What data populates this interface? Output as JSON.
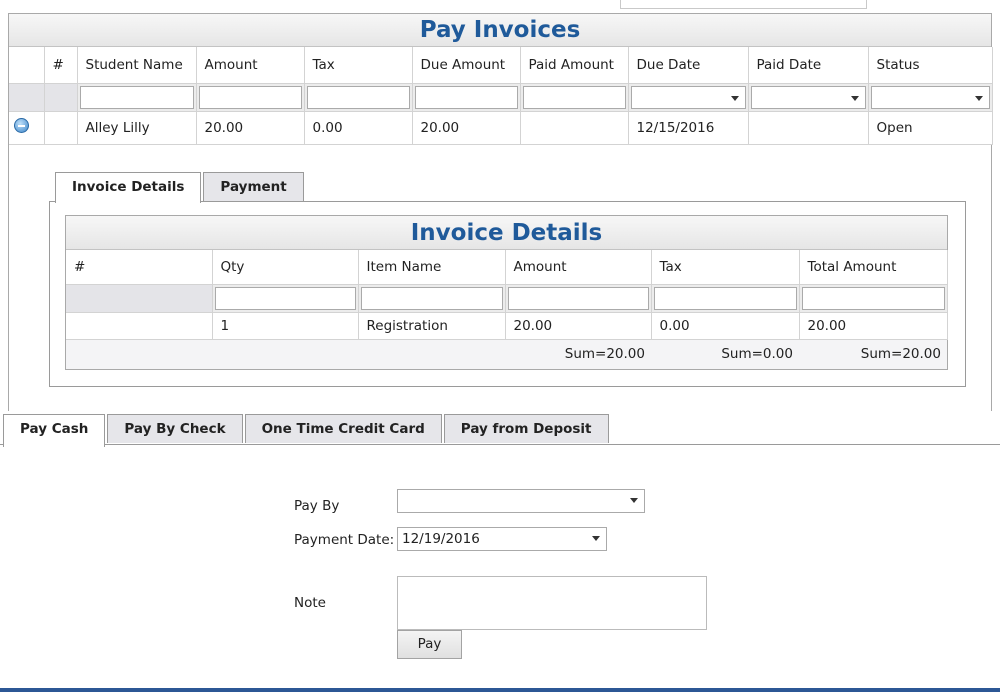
{
  "main_grid": {
    "title": "Pay Invoices",
    "columns": [
      "#",
      "Student Name",
      "Amount",
      "Tax",
      "Due Amount",
      "Paid Amount",
      "Due Date",
      "Paid Date",
      "Status"
    ],
    "row": {
      "student_name": "Alley Lilly",
      "amount": "20.00",
      "tax": "0.00",
      "due_amount": "20.00",
      "paid_amount": "",
      "due_date": "12/15/2016",
      "paid_date": "",
      "status": "Open"
    }
  },
  "sub_tabs": [
    "Invoice Details",
    "Payment"
  ],
  "invoice_details": {
    "title": "Invoice Details",
    "columns": [
      "#",
      "Qty",
      "Item Name",
      "Amount",
      "Tax",
      "Total Amount"
    ],
    "row": {
      "qty": "1",
      "item_name": "Registration",
      "amount": "20.00",
      "tax": "0.00",
      "total_amount": "20.00"
    },
    "sums": {
      "amount": "Sum=20.00",
      "tax": "Sum=0.00",
      "total": "Sum=20.00"
    }
  },
  "pay_tabs": [
    "Pay Cash",
    "Pay By Check",
    "One Time Credit Card",
    "Pay from Deposit"
  ],
  "form": {
    "pay_by_label": "Pay By",
    "pay_by_value": "",
    "payment_date_label": "Payment Date:",
    "payment_date_value": "12/19/2016",
    "note_label": "Note",
    "pay_button": "Pay"
  },
  "colors": {
    "title_blue": "#1f5a9a",
    "bottom_bar": "#2c5795"
  }
}
